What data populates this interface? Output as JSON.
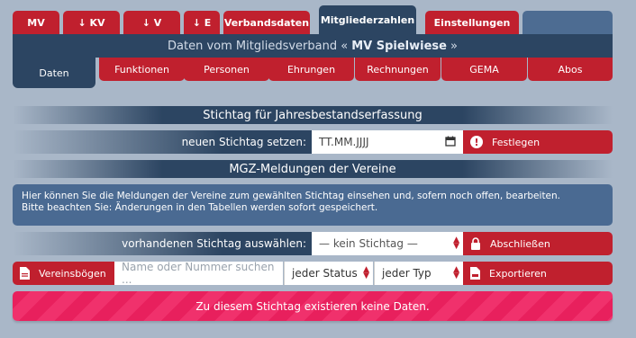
{
  "tabs": [
    {
      "label": "MV"
    },
    {
      "label": "↓ KV"
    },
    {
      "label": "↓ V"
    },
    {
      "label": "↓ E"
    },
    {
      "label": "Verbandsdaten"
    },
    {
      "label": "Mitgliederzahlen"
    },
    {
      "label": "Einstellungen"
    }
  ],
  "subbar": {
    "prefix": "Daten vom Mitgliedsverband «",
    "name": "MV Spielwiese",
    "suffix": "»"
  },
  "subtabs": [
    {
      "label": "Daten"
    },
    {
      "label": "Funktionen"
    },
    {
      "label": "Personen"
    },
    {
      "label": "Ehrungen"
    },
    {
      "label": "Rechnungen"
    },
    {
      "label": "GEMA"
    },
    {
      "label": "Abos"
    }
  ],
  "stichtag": {
    "heading": "Stichtag für Jahresbestandserfassung",
    "label": "neuen Stichtag setzen:",
    "placeholder": "TT.MM.JJJJ",
    "button": "Festlegen"
  },
  "meldungen": {
    "heading": "MGZ-Meldungen der Vereine",
    "info_line1": "Hier können Sie die Meldungen der Vereine zum gewählten Stichtag einsehen und, sofern noch offen, bearbeiten.",
    "info_line2": "Bitte beachten Sie: Änderungen in den Tabellen werden sofort gespeichert.",
    "select_label": "vorhandenen Stichtag auswählen:",
    "select_value": "— kein Stichtag —",
    "lock_button": "Abschließen",
    "vereinsboegen_button": "Vereinsbögen",
    "search_placeholder": "Name oder Nummer suchen ...",
    "status_value": "jeder Status",
    "typ_value": "jeder Typ",
    "export_button": "Exportieren",
    "empty_message": "Zu diesem Stichtag existieren keine Daten."
  },
  "colors": {
    "accent": "#c0202e",
    "navy": "#2c4562",
    "alert": "#e8205d"
  }
}
